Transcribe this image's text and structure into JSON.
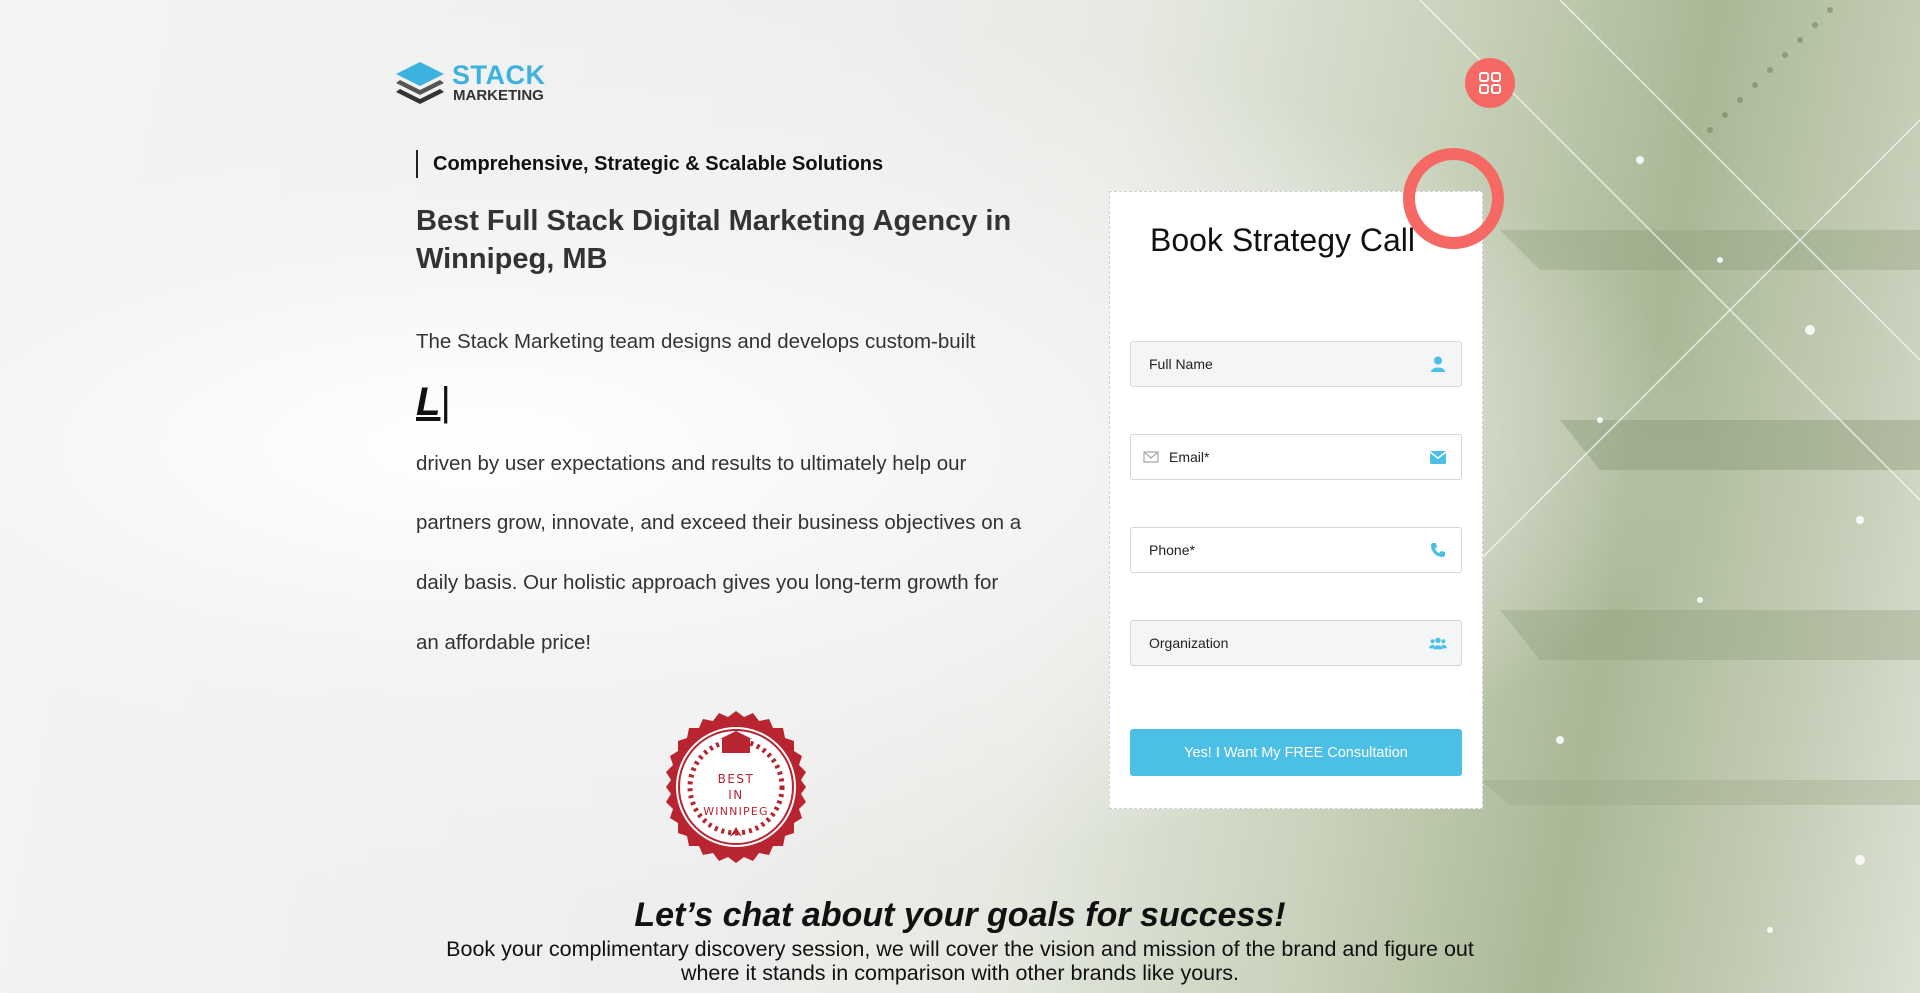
{
  "brand": {
    "logo_line1": "STACK",
    "logo_line2": "MARKETING",
    "accent_color": "#4bbfe5",
    "highlight_color": "#f56864"
  },
  "header": {
    "menu_icon": "grid-menu-icon"
  },
  "hero": {
    "tagline": "Comprehensive, Strategic & Scalable Solutions",
    "headline": "Best Full Stack Digital Marketing Agency in Winnipeg, MB",
    "paragraph_lines": [
      "The Stack Marketing team designs and develops custom-built",
      "driven by user expectations and results to ultimately help our",
      "partners grow, innovate, and exceed their business objectives on a",
      "daily basis. Our holistic approach gives you long-term growth for",
      "an affordable price!"
    ],
    "typed_word": "L",
    "typed_cursor": "|",
    "badge": {
      "line1": "BEST",
      "line2": "IN",
      "line3": "WINNIPEG",
      "color": "#b8242f"
    }
  },
  "form": {
    "title": "Book Strategy Call",
    "fields": [
      {
        "placeholder": "Full Name",
        "icon": "user-icon"
      },
      {
        "placeholder": "Email*",
        "icon": "envelope-icon",
        "lead_icon": "mail-outline-icon"
      },
      {
        "placeholder": "Phone*",
        "icon": "phone-icon"
      },
      {
        "placeholder": "Organization",
        "icon": "users-icon"
      }
    ],
    "submit_label": "Yes! I Want My FREE Consultation"
  },
  "cta": {
    "heading": "Let’s chat about your goals for success!",
    "sub_line1": "Book your complimentary discovery session, we will cover the vision and mission of the brand and figure out",
    "sub_line2": "where it stands in comparison with other brands like yours."
  }
}
